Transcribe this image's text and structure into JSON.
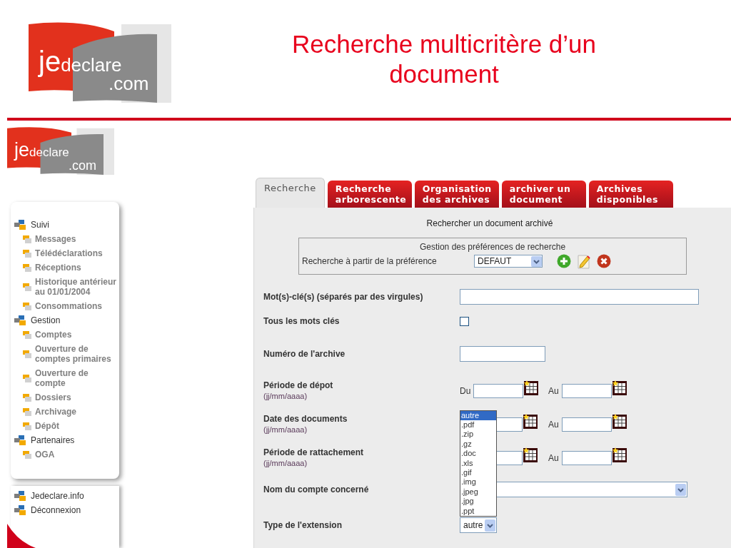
{
  "slide": {
    "logo": {
      "prefix": "je",
      "name": "declare",
      "suffix": ".com"
    },
    "title": "Recherche multicritère d’un document"
  },
  "app_logo": {
    "prefix": "je",
    "name": "declare",
    "suffix": ".com"
  },
  "sidebar": {
    "items": [
      {
        "label": "Suivi",
        "children": [
          {
            "label": "Messages"
          },
          {
            "label": "Télédéclarations"
          },
          {
            "label": "Réceptions"
          },
          {
            "label": "Historique antérieur au 01/01/2004"
          },
          {
            "label": "Consommations"
          }
        ]
      },
      {
        "label": "Gestion",
        "children": [
          {
            "label": "Comptes"
          },
          {
            "label": "Ouverture de comptes primaires"
          },
          {
            "label": "Ouverture de compte"
          },
          {
            "label": "Dossiers"
          },
          {
            "label": "Archivage"
          },
          {
            "label": "Dépôt"
          }
        ]
      },
      {
        "label": "Partenaires",
        "children": [
          {
            "label": "OGA"
          }
        ]
      }
    ],
    "footer_items": [
      {
        "label": "Jedeclare.info"
      },
      {
        "label": "Déconnexion"
      }
    ]
  },
  "tabs": [
    {
      "label": "Recherche",
      "selected": true
    },
    {
      "label": "Recherche arborescente",
      "selected": false
    },
    {
      "label": "Organisation des archives",
      "selected": false
    },
    {
      "label": "archiver un document",
      "selected": false
    },
    {
      "label": "Archives disponibles",
      "selected": false
    }
  ],
  "panel": {
    "title": "Rechercher un document archivé",
    "preferences": {
      "title": "Gestion des préférences de recherche",
      "label": "Recherche à partir de la préférence",
      "value": "DEFAUT"
    },
    "rows": [
      {
        "kind": "text",
        "label": "Mot(s)-clé(s) (séparés par des virgules)"
      },
      {
        "kind": "checkbox",
        "label": "Tous les mots clés",
        "checked": false
      },
      {
        "kind": "text",
        "label": "Numéro de l'archive"
      },
      {
        "kind": "daterange",
        "label": "Période de dépot",
        "hint": "(jj/mm/aaaa)",
        "from_label": "Du",
        "to_label": "Au"
      },
      {
        "kind": "daterange",
        "label": "Date des documents",
        "hint": "(jj/mm/aaaa)",
        "to_label": "Au"
      },
      {
        "kind": "daterange",
        "label": "Période de rattachement",
        "hint": "(jj/mm/aaaa)",
        "to_label": "Au"
      },
      {
        "kind": "select",
        "label": "Nom du compte concerné"
      },
      {
        "kind": "select",
        "label": "Type de l'extension",
        "value": "autre",
        "expanded": true,
        "options": [
          {
            "label": "autre",
            "selected": true
          },
          {
            "label": ".pdf",
            "selected": false
          },
          {
            "label": ".zip",
            "selected": false
          },
          {
            "label": ".gz",
            "selected": false
          },
          {
            "label": ".doc",
            "selected": false
          },
          {
            "label": ".xls",
            "selected": false
          },
          {
            "label": ".gif",
            "selected": false
          },
          {
            "label": ".img",
            "selected": false
          },
          {
            "label": ".jpeg",
            "selected": false
          },
          {
            "label": ".jpg",
            "selected": false
          },
          {
            "label": ".ppt",
            "selected": false
          }
        ]
      }
    ]
  }
}
